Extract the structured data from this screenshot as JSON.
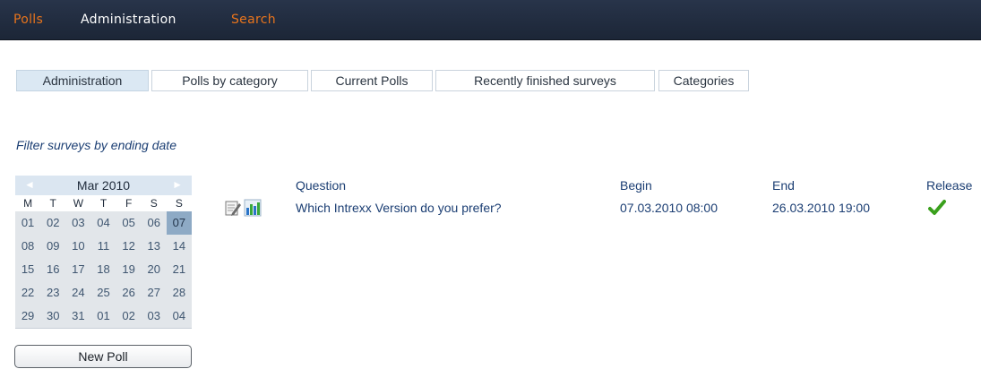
{
  "topnav": {
    "polls": "Polls",
    "administration": "Administration",
    "search": "Search"
  },
  "tabs": [
    {
      "label": "Administration",
      "active": true
    },
    {
      "label": "Polls by category",
      "active": false
    },
    {
      "label": "Current Polls",
      "active": false
    },
    {
      "label": "Recently finished surveys",
      "active": false
    },
    {
      "label": "Categories",
      "active": false
    }
  ],
  "filter_heading": "Filter surveys by ending date",
  "calendar": {
    "month": "Mar 2010",
    "prev_glyph": "◄",
    "next_glyph": "►",
    "weekdays": [
      "M",
      "T",
      "W",
      "T",
      "F",
      "S",
      "S"
    ],
    "weeks": [
      [
        "01",
        "02",
        "03",
        "04",
        "05",
        "06",
        "07"
      ],
      [
        "08",
        "09",
        "10",
        "11",
        "12",
        "13",
        "14"
      ],
      [
        "15",
        "16",
        "17",
        "18",
        "19",
        "20",
        "21"
      ],
      [
        "22",
        "23",
        "24",
        "25",
        "26",
        "27",
        "28"
      ],
      [
        "29",
        "30",
        "31",
        "01",
        "02",
        "03",
        "04"
      ]
    ],
    "selected_day": "07"
  },
  "new_poll_label": "New Poll",
  "table": {
    "headers": {
      "question": "Question",
      "begin": "Begin",
      "end": "End",
      "released": "Release"
    },
    "rows": [
      {
        "question": "Which Intrexx Version do you prefer?",
        "begin": "07.03.2010 08:00",
        "end": "26.03.2010 19:00",
        "released": true,
        "icons": [
          "edit-icon",
          "results-chart-icon"
        ]
      }
    ]
  },
  "colors": {
    "topbar": "#1c2637",
    "accent_orange": "#e8741c",
    "active_tab": "#dbe8f3",
    "link_blue": "#1b3e73",
    "calendar_selected": "#8eaac5",
    "check_green": "#3aa01c"
  }
}
